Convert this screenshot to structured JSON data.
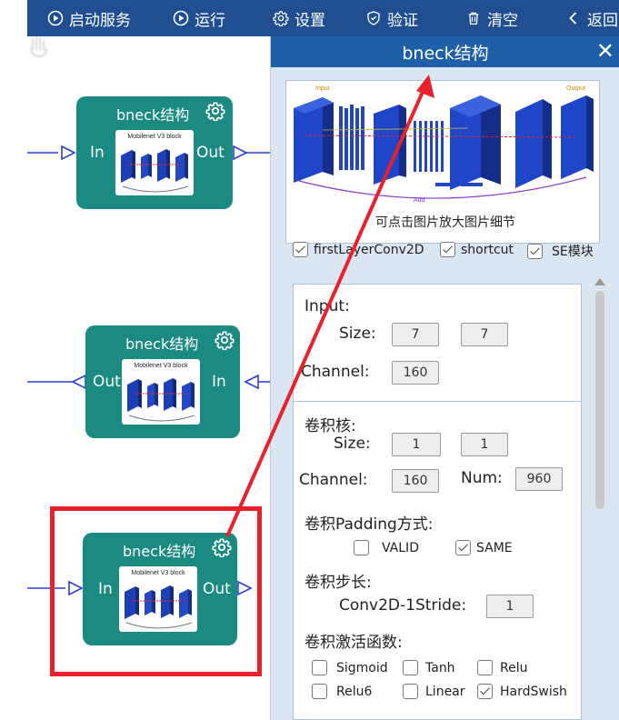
{
  "toolbar": {
    "start_service": "启动服务",
    "run": "运行",
    "settings": "设置",
    "verify": "验证",
    "clear": "清空",
    "back": "返回"
  },
  "nodes": [
    {
      "title": "bneck结构",
      "left_port": "In",
      "right_port": "Out",
      "thumb_label": "Mobilenet V3 block"
    },
    {
      "title": "bneck结构",
      "left_port": "Out",
      "right_port": "In",
      "thumb_label": "Mobilenet V3 block"
    },
    {
      "title": "bneck结构",
      "left_port": "In",
      "right_port": "Out",
      "thumb_label": "Mobilenet V3 block"
    }
  ],
  "panel": {
    "title": "bneck结构",
    "diagram": {
      "input": "Input",
      "output": "Output",
      "add": "Add"
    },
    "hint": "可点击图片放大图片细节",
    "options": [
      {
        "label": "firstLayerConv2D",
        "checked": true
      },
      {
        "label": "shortcut",
        "checked": true
      },
      {
        "label": "SE模块",
        "checked": true
      }
    ],
    "input_section": {
      "heading": "Input:",
      "size_label": "Size:",
      "size_w": "7",
      "size_h": "7",
      "channel_label": "Channel:",
      "channel": "160"
    },
    "kernel_section": {
      "heading": "卷积核:",
      "size_label": "Size:",
      "size_w": "1",
      "size_h": "1",
      "channel_label": "Channel:",
      "channel": "160",
      "num_label": "Num:",
      "num": "960",
      "padding_label": "卷积Padding方式:",
      "padding_valid": "VALID",
      "padding_same": "SAME",
      "stride_label": "卷积步长:",
      "stride_field_label": "Conv2D-1Stride:",
      "stride": "1",
      "activation_label": "卷积激活函数:",
      "activations": [
        {
          "label": "Sigmoid",
          "checked": false
        },
        {
          "label": "Tanh",
          "checked": false
        },
        {
          "label": "Relu",
          "checked": false
        },
        {
          "label": "Relu6",
          "checked": false
        },
        {
          "label": "Linear",
          "checked": false
        },
        {
          "label": "HardSwish",
          "checked": true
        }
      ]
    }
  },
  "colors": {
    "toolbar": "#1f4e91",
    "node": "#1b8a80",
    "panel_header": "#1f5fa8",
    "highlight": "#e8212c",
    "wire": "#2a3fd8"
  }
}
